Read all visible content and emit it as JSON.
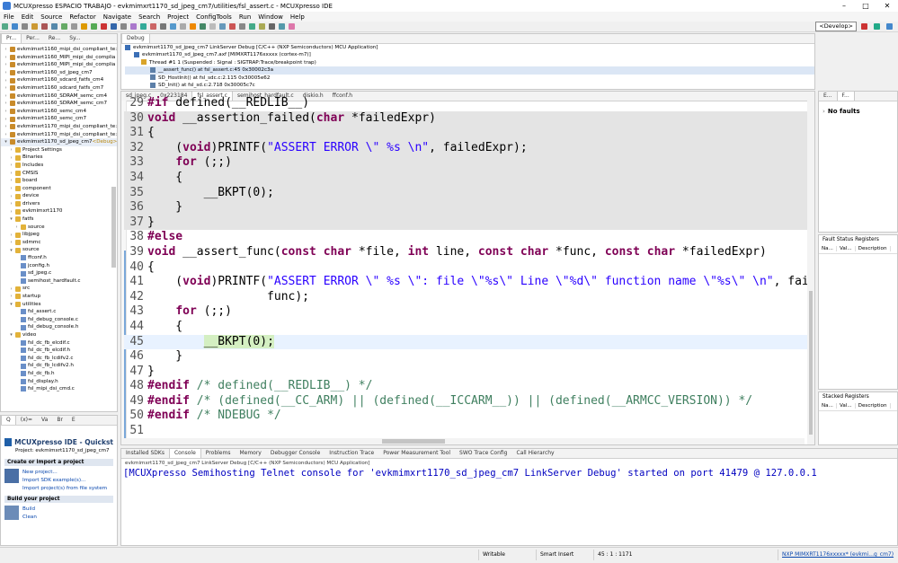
{
  "window": {
    "title": "MCUXpresso ESPACIO TRABAJO - evkmimxrt1170_sd_jpeg_cm7/utilities/fsl_assert.c - MCUXpresso IDE"
  },
  "menu": [
    "File",
    "Edit",
    "Source",
    "Refactor",
    "Navigate",
    "Search",
    "Project",
    "ConfigTools",
    "Run",
    "Window",
    "Help"
  ],
  "toolbar": {
    "perspective": "<Develop>"
  },
  "left_tabs": [
    "Pr...",
    "Per...",
    "Re...",
    "Sy..."
  ],
  "project_tree": [
    {
      "label": "evkmimxrt1160_mipi_dsi_compliant_te:",
      "type": "proj",
      "indent": 0
    },
    {
      "label": "evkmimxrt1160_MIPI_mipi_dsi_complia",
      "type": "proj",
      "indent": 0
    },
    {
      "label": "evkmimxrt1160_MIPI_mipi_dsi_complia",
      "type": "proj",
      "indent": 0
    },
    {
      "label": "evkmimxrt1160_sd_jpeg_cm7",
      "type": "proj",
      "indent": 0
    },
    {
      "label": "evkmimxrt1160_sdcard_fatfs_cm4",
      "type": "proj",
      "indent": 0
    },
    {
      "label": "evkmimxrt1160_sdcard_fatfs_cm7",
      "type": "proj",
      "indent": 0
    },
    {
      "label": "evkmimxrt1160_SDRAM_semc_cm4",
      "type": "proj",
      "indent": 0
    },
    {
      "label": "evkmimxrt1160_SDRAM_semc_cm7",
      "type": "proj",
      "indent": 0
    },
    {
      "label": "evkmimxrt1160_semc_cm4",
      "type": "proj",
      "indent": 0
    },
    {
      "label": "evkmimxrt1160_semc_cm7",
      "type": "proj",
      "indent": 0
    },
    {
      "label": "evkmimxrt1170_mipi_dsi_compliant_te:",
      "type": "proj",
      "indent": 0
    },
    {
      "label": "evkmimxrt1170_mipi_dsi_compliant_te:",
      "type": "proj",
      "indent": 0
    },
    {
      "label": "evkmimxrt1170_sd_jpeg_cm7",
      "type": "proj",
      "indent": 0,
      "tag": "<Debug>",
      "open": true
    },
    {
      "label": "Project Settings",
      "type": "fold",
      "indent": 1
    },
    {
      "label": "Binaries",
      "type": "fold",
      "indent": 1
    },
    {
      "label": "Includes",
      "type": "fold",
      "indent": 1
    },
    {
      "label": "CMSIS",
      "type": "fold",
      "indent": 1
    },
    {
      "label": "board",
      "type": "fold",
      "indent": 1
    },
    {
      "label": "component",
      "type": "fold",
      "indent": 1
    },
    {
      "label": "device",
      "type": "fold",
      "indent": 1
    },
    {
      "label": "drivers",
      "type": "fold",
      "indent": 1
    },
    {
      "label": "evkmimxrt1170",
      "type": "fold",
      "indent": 1
    },
    {
      "label": "fatfs",
      "type": "fold",
      "indent": 1,
      "open": true
    },
    {
      "label": "source",
      "type": "fold",
      "indent": 2
    },
    {
      "label": "libjpeg",
      "type": "fold",
      "indent": 1
    },
    {
      "label": "sdmmc",
      "type": "fold",
      "indent": 1
    },
    {
      "label": "source",
      "type": "fold",
      "indent": 1,
      "open": true
    },
    {
      "label": "ffconf.h",
      "type": "file",
      "indent": 2
    },
    {
      "label": "jconfig.h",
      "type": "file",
      "indent": 2
    },
    {
      "label": "sd_jpeg.c",
      "type": "file",
      "indent": 2
    },
    {
      "label": "semihost_hardfault.c",
      "type": "file",
      "indent": 2
    },
    {
      "label": "src",
      "type": "fold",
      "indent": 1
    },
    {
      "label": "startup",
      "type": "fold",
      "indent": 1
    },
    {
      "label": "utilities",
      "type": "fold",
      "indent": 1,
      "open": true
    },
    {
      "label": "fsl_assert.c",
      "type": "file",
      "indent": 2
    },
    {
      "label": "fsl_debug_console.c",
      "type": "file",
      "indent": 2
    },
    {
      "label": "fsl_debug_console.h",
      "type": "file",
      "indent": 2
    },
    {
      "label": "video",
      "type": "fold",
      "indent": 1,
      "open": true
    },
    {
      "label": "fsl_dc_fb_elcdif.c",
      "type": "file",
      "indent": 2
    },
    {
      "label": "fsl_dc_fb_elcdif.h",
      "type": "file",
      "indent": 2
    },
    {
      "label": "fsl_dc_fb_lcdifv2.c",
      "type": "file",
      "indent": 2
    },
    {
      "label": "fsl_dc_fb_lcdifv2.h",
      "type": "file",
      "indent": 2
    },
    {
      "label": "fsl_dc_fb.h",
      "type": "file",
      "indent": 2
    },
    {
      "label": "fsl_display.h",
      "type": "file",
      "indent": 2
    },
    {
      "label": "fsl_mipi_dsi_cmd.c",
      "type": "file",
      "indent": 2
    }
  ],
  "quickstart": {
    "tabs": [
      "Q",
      "(x)=",
      "Va",
      "Br",
      "E"
    ],
    "title": "MCUXpresso IDE - Quickst",
    "project": "Project: evkmimxrt1170_sd_jpeg_cm7",
    "section1": "Create or import a project",
    "links1": [
      "New project...",
      "Import SDK example(s)...",
      "Import project(s) from file system"
    ],
    "section2": "Build your project",
    "links2": [
      "Build",
      "Clean"
    ]
  },
  "debug": {
    "tab": "Debug",
    "rows": [
      "evkmimxrt1170_sd_jpeg_cm7 LinkServer Debug [C/C++ (NXP Semiconductors) MCU Application]",
      "evkmimxrt1170_sd_jpeg_cm7.axf [MIMXRT1176xxxxx (cortex-m7)]",
      "Thread #1 1 (Suspended : Signal : SIGTRAP:Trace/breakpoint trap)",
      "__assert_func() at fsl_assert.c:45 0x30002c3a",
      "SD_HostInit() at fsl_sdc.c:2.115 0x30005e62",
      "SD_Init() at fsl_sd.c:2.718 0x30005c7c"
    ]
  },
  "editor_tabs": [
    "sd_jpeg.c",
    "0x223184",
    "fsl_assert.c",
    "semihost_hardfault.c",
    "diskio.h",
    "ffconf.h"
  ],
  "code_lines": [
    {
      "n": "29",
      "t": "#if defined(__REDLIB__)"
    },
    {
      "n": "30",
      "t": "void __assertion_failed(char *failedExpr)"
    },
    {
      "n": "31",
      "t": "{"
    },
    {
      "n": "32",
      "t": "    (void)PRINTF(\"ASSERT ERROR \\\" %s \\n\", failedExpr);"
    },
    {
      "n": "33",
      "t": "    for (;;)"
    },
    {
      "n": "34",
      "t": "    {"
    },
    {
      "n": "35",
      "t": "        __BKPT(0);"
    },
    {
      "n": "36",
      "t": "    }"
    },
    {
      "n": "37",
      "t": "}"
    },
    {
      "n": "38",
      "t": "#else"
    },
    {
      "n": "39",
      "t": "void __assert_func(const char *file, int line, const char *func, const char *failedExpr)"
    },
    {
      "n": "40",
      "t": "{"
    },
    {
      "n": "41",
      "t": "    (void)PRINTF(\"ASSERT ERROR \\\" %s \\\": file \\\"%s\\\" Line \\\"%d\\\" function name \\\"%s\\\" \\n\", fai"
    },
    {
      "n": "42",
      "t": "                 func);"
    },
    {
      "n": "43",
      "t": "    for (;;)"
    },
    {
      "n": "44",
      "t": "    {"
    },
    {
      "n": "45",
      "t": "        __BKPT(0);"
    },
    {
      "n": "46",
      "t": "    }"
    },
    {
      "n": "47",
      "t": "}"
    },
    {
      "n": "48",
      "t": "#endif /* defined(__REDLIB__) */"
    },
    {
      "n": "49",
      "t": "#endif /* (defined(__CC_ARM) || (defined(__ICCARM__)) || (defined(__ARMCC_VERSION)) */"
    },
    {
      "n": "50",
      "t": "#endif /* NDEBUG */"
    },
    {
      "n": "51",
      "t": ""
    }
  ],
  "right_top": {
    "tabs": [
      "E...",
      "F..."
    ],
    "no_faults": "No faults"
  },
  "fault_registers": {
    "title": "Fault Status Registers",
    "cols": [
      "Na...",
      "Val...",
      "Description"
    ]
  },
  "stacked_registers": {
    "title": "Stacked Registers",
    "cols": [
      "Na...",
      "Val...",
      "Description"
    ]
  },
  "bottom_tabs": [
    "Installed SDKs",
    "Console",
    "Problems",
    "Memory",
    "Debugger Console",
    "Instruction Trace",
    "Power Measurement Tool",
    "SWO Trace Config",
    "Call Hierarchy"
  ],
  "console": {
    "header": "evkmimxrt1170_sd_jpeg_cm7 LinkServer Debug [C/C++ (NXP Semiconductors) MCU Application]",
    "text": "[MCUXpresso Semihosting Telnet console for 'evkmimxrt1170_sd_jpeg_cm7 LinkServer Debug' started on port 41479 @ 127.0.0.1"
  },
  "status": {
    "writable": "Writable",
    "insert": "Smart Insert",
    "position": "45 : 1 : 1171",
    "target": "NXP MIMXRT1176xxxxx* (evkmi...g_cm7)"
  },
  "colors": {
    "breakpoint_line": "#d4efc2",
    "disabled_block": "#e4e4e4",
    "keyword": "#7f0055",
    "string": "#2a00ff",
    "comment": "#3f7f5f",
    "link": "#0645ad"
  }
}
